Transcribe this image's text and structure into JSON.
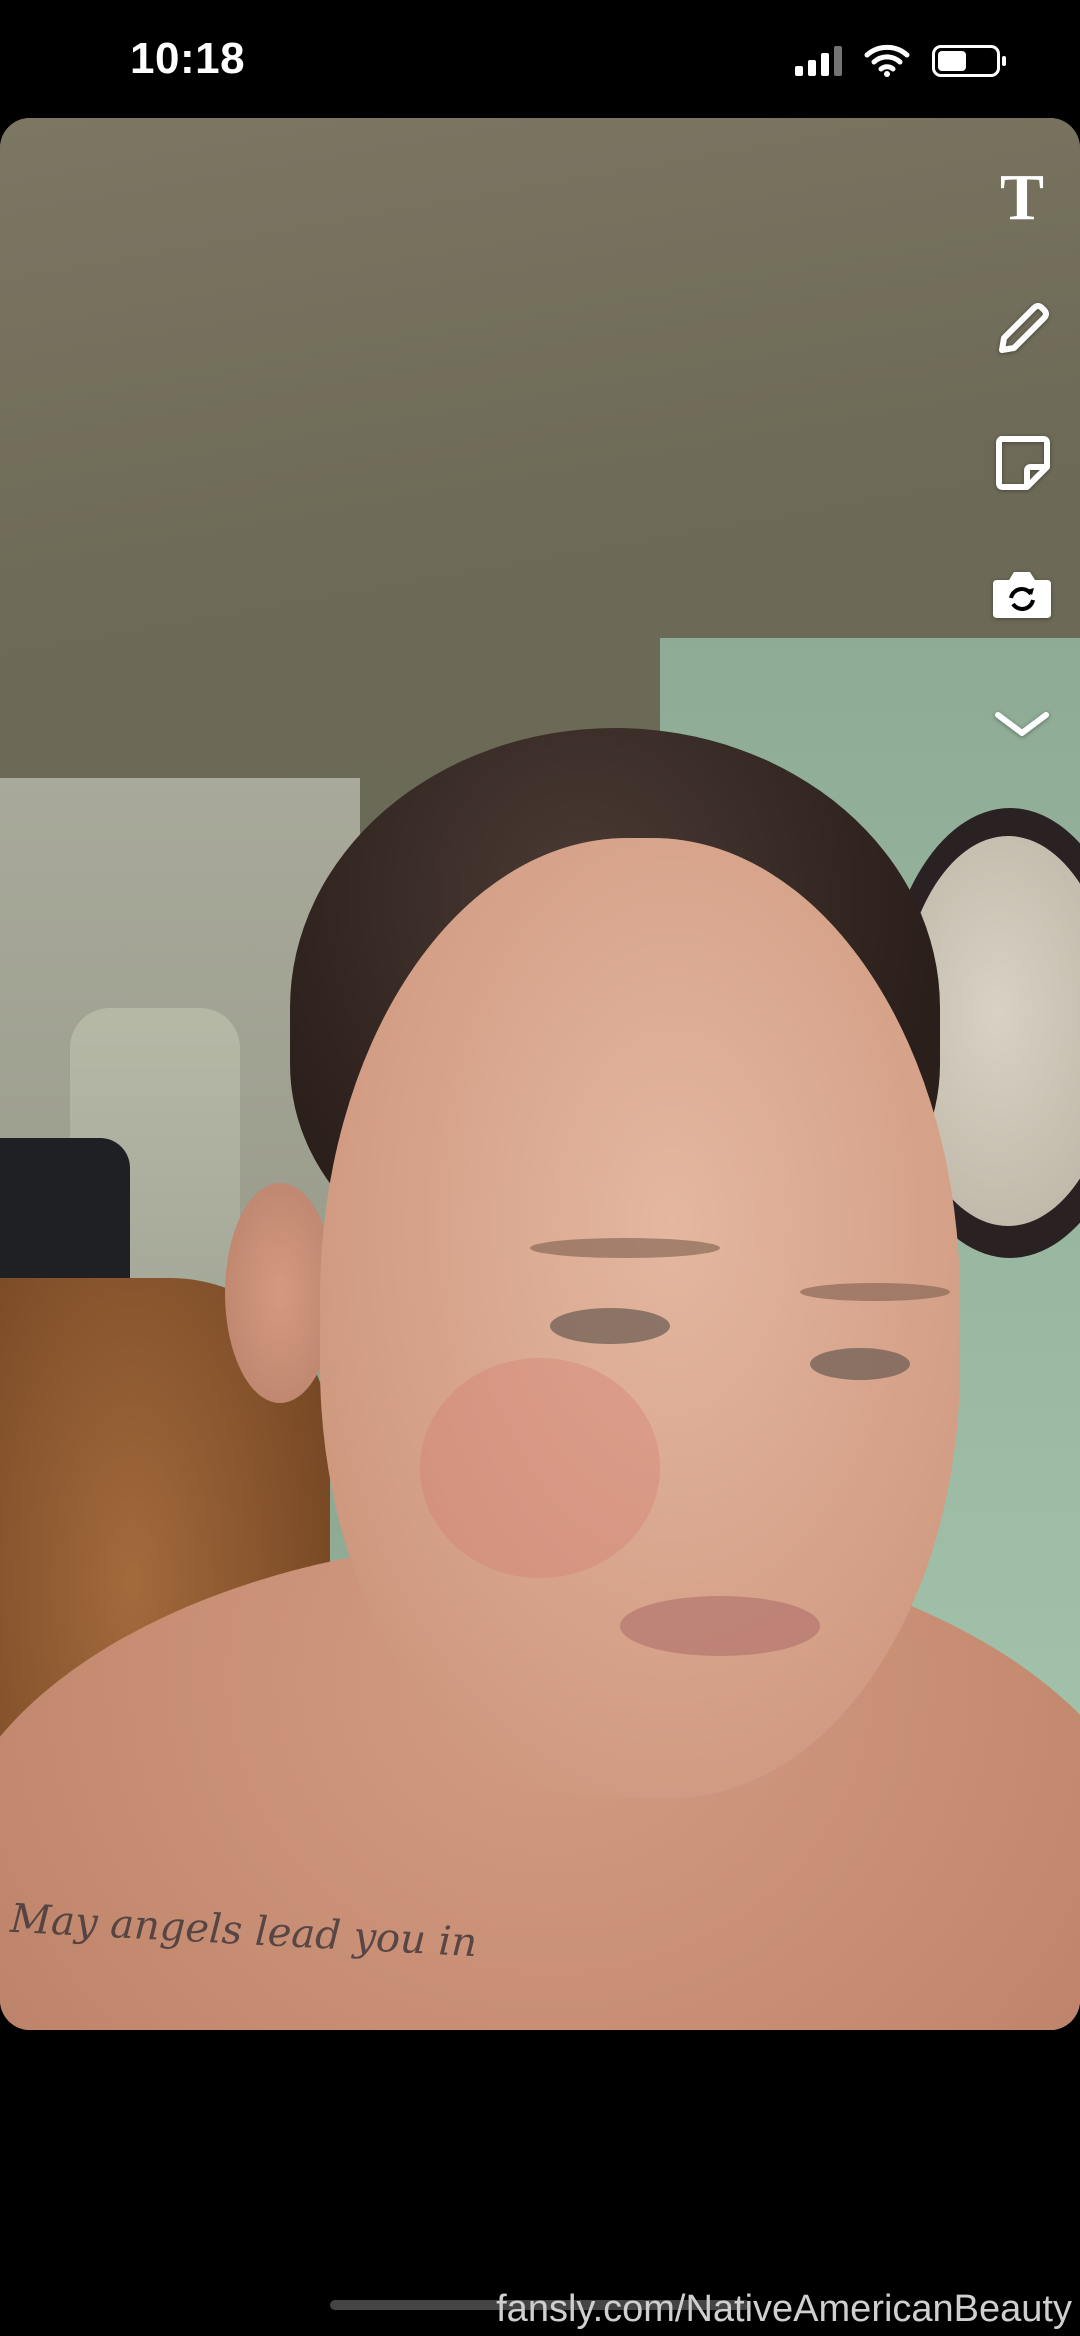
{
  "status_bar": {
    "time": "10:18",
    "signal_icon": "cellular-signal-icon",
    "wifi_icon": "wifi-icon",
    "battery_icon": "battery-icon",
    "battery_level": 0.45
  },
  "toolbar": {
    "text_tool_glyph": "T",
    "items": [
      {
        "name": "text-tool",
        "icon": "text-icon"
      },
      {
        "name": "pencil-tool",
        "icon": "pencil-icon"
      },
      {
        "name": "sticker-tool",
        "icon": "sticker-icon"
      },
      {
        "name": "camera-flip-tool",
        "icon": "camera-flip-icon"
      },
      {
        "name": "more-tools",
        "icon": "chevron-down-icon"
      }
    ]
  },
  "photo": {
    "tattoo_text": "May angels lead you in"
  },
  "swipe_up": {
    "icon": "chevron-up-icon"
  },
  "watermark": "fansly.com/NativeAmericanBeauty",
  "colors": {
    "background": "#000000",
    "icon": "#ffffff"
  }
}
